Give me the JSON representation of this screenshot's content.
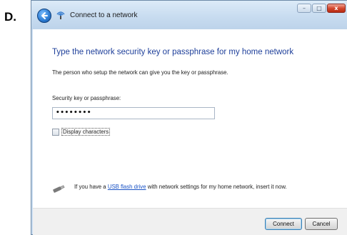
{
  "figure_label": "D.",
  "window": {
    "title": "Connect to a network",
    "heading": "Type the network security key or passphrase for my home network",
    "description": "The person who setup the network can give you the key or passphrase.",
    "key_label": "Security key or passphrase:",
    "key_value": "••••••••",
    "display_characters_label": "Display characters",
    "display_characters_checked": false,
    "usb_text_before": "If you have a ",
    "usb_link": "USB flash drive",
    "usb_text_after": " with network settings for my home network, insert it now."
  },
  "buttons": {
    "connect": "Connect",
    "cancel": "Cancel"
  },
  "caption": {
    "minimize": "–",
    "maximize": "□",
    "close": "x"
  },
  "colors": {
    "heading": "#1e3f9a",
    "link": "#1a53c5",
    "titlebar": "#c8dcf0",
    "close_button": "#d4492f"
  }
}
